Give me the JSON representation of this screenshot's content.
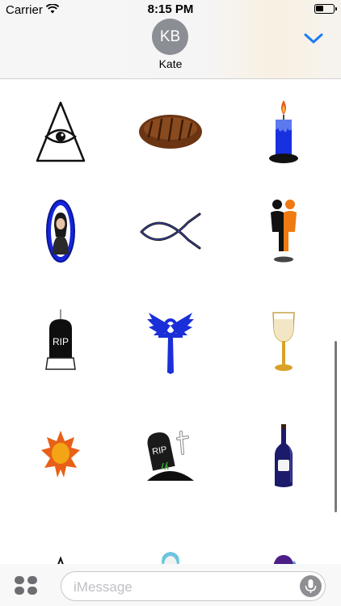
{
  "status_bar": {
    "carrier": "Carrier",
    "time": "8:15 PM"
  },
  "header": {
    "avatar_initials": "KB",
    "contact_name": "Kate"
  },
  "stickers": [
    {
      "name": "eye-of-providence"
    },
    {
      "name": "bread-loaf"
    },
    {
      "name": "blue-candle"
    },
    {
      "name": "person-portrait-oval"
    },
    {
      "name": "ichthys-fish"
    },
    {
      "name": "couple-figures"
    },
    {
      "name": "rip-tombstone-candle"
    },
    {
      "name": "winged-ankh"
    },
    {
      "name": "wine-glass"
    },
    {
      "name": "orange-sun"
    },
    {
      "name": "rip-grave-with-cross"
    },
    {
      "name": "wine-bottle"
    },
    {
      "name": "triangle-partial"
    },
    {
      "name": "angel-partial"
    },
    {
      "name": "hooded-figure-partial"
    }
  ],
  "rip_text": "RIP",
  "message_input": {
    "placeholder": "iMessage"
  },
  "icons": [
    "wifi-icon",
    "battery-icon",
    "chevron-down-icon",
    "app-drawer-icon",
    "microphone-icon"
  ],
  "colors": {
    "accent": "#1b7cf5",
    "avatar_bg": "#8c8e95"
  }
}
